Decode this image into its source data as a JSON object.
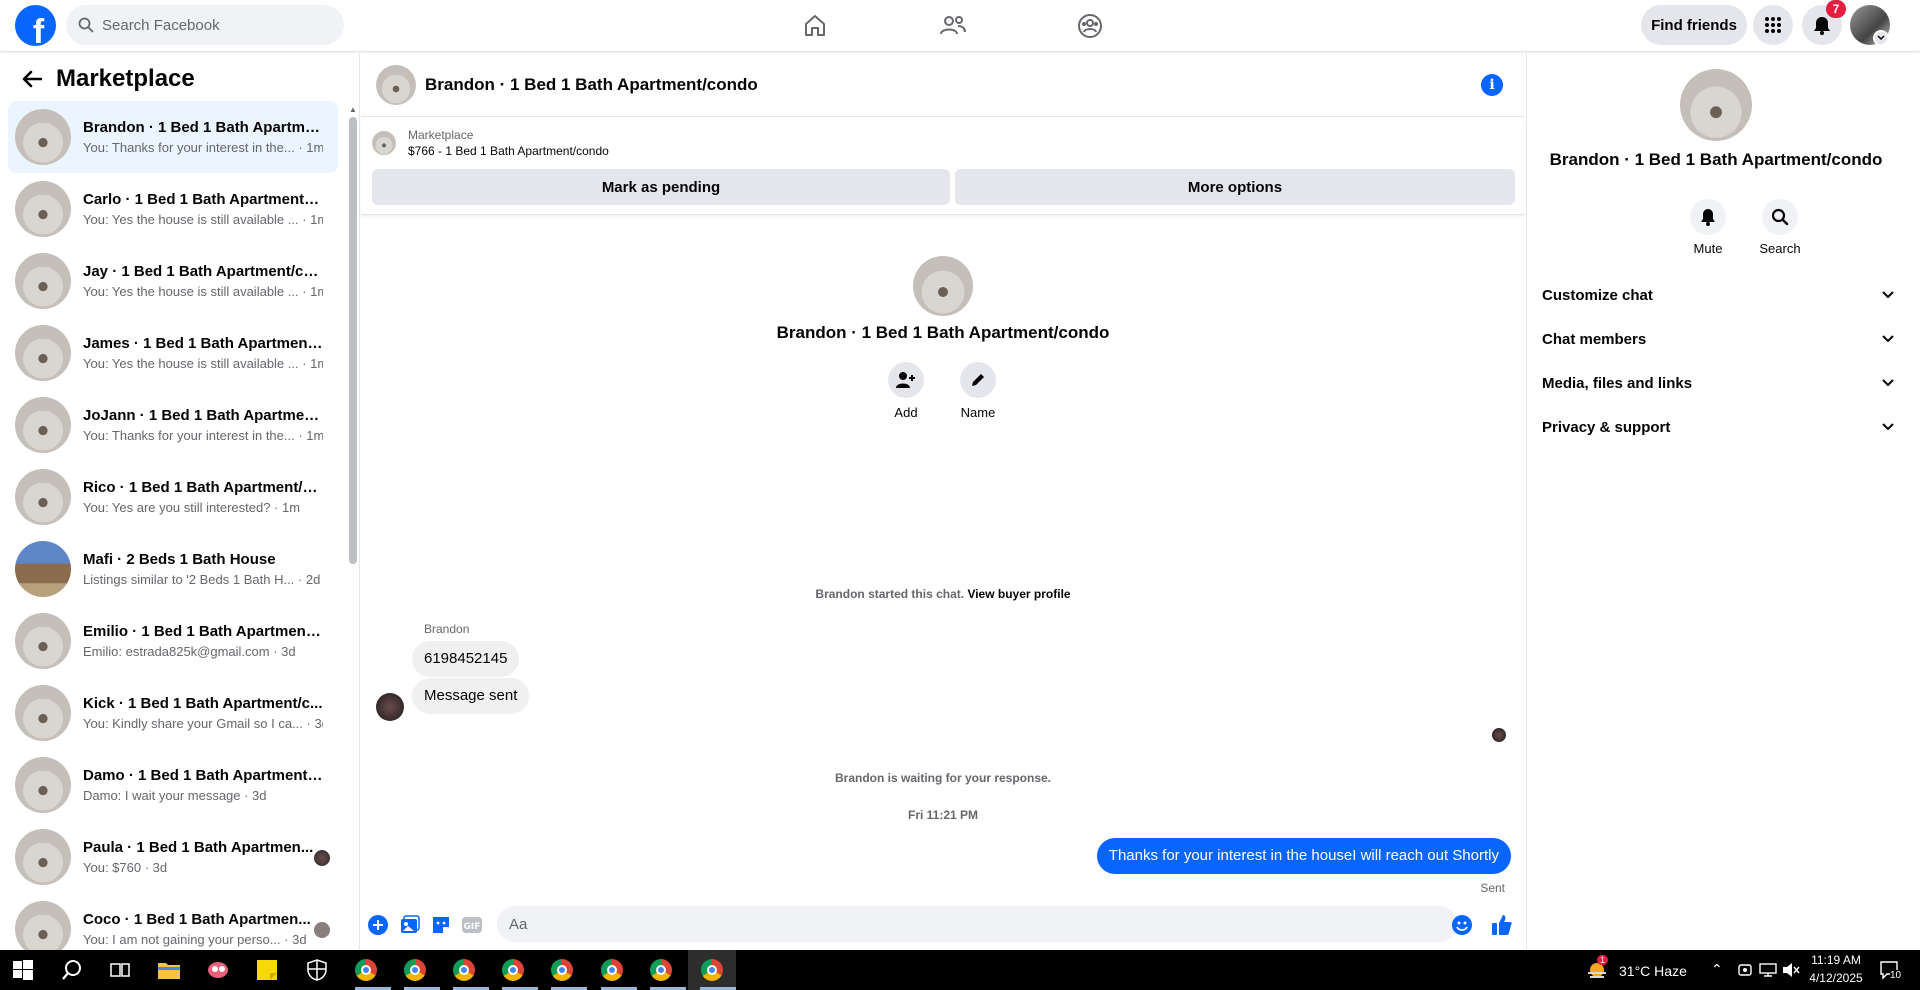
{
  "topbar": {
    "logo": "f",
    "search_placeholder": "Search Facebook",
    "find_friends": "Find friends",
    "notification_count": "7"
  },
  "sidebar": {
    "title": "Marketplace",
    "conversations": [
      {
        "title": "Brandon · 1 Bed 1 Bath Apartme...",
        "sub": "You: Thanks for your interest in the... · 1m"
      },
      {
        "title": "Carlo · 1 Bed 1 Bath Apartment/c...",
        "sub": "You: Yes the house is still available ... · 1m"
      },
      {
        "title": "Jay · 1 Bed 1 Bath Apartment/co...",
        "sub": "You: Yes the house is still available ... · 1m"
      },
      {
        "title": "James · 1 Bed 1 Bath Apartment/...",
        "sub": "You: Yes the house is still available ... · 1m"
      },
      {
        "title": "JoJann · 1 Bed 1 Bath Apartment...",
        "sub": "You: Thanks for your interest in the... · 1m"
      },
      {
        "title": "Rico · 1 Bed 1 Bath Apartment/c...",
        "sub": "You: Yes are you still interested? · 1m"
      },
      {
        "title": "Mafi · 2 Beds 1 Bath House",
        "sub": "Listings similar to '2 Beds 1 Bath H... · 2d"
      },
      {
        "title": "Emilio · 1 Bed 1 Bath Apartment/...",
        "sub": "Emilio: estrada825k@gmail.com · 3d"
      },
      {
        "title": "Kick · 1 Bed 1 Bath Apartment/c...",
        "sub": "You: Kindly share your Gmail so I ca... · 3d"
      },
      {
        "title": "Damo · 1 Bed 1 Bath Apartment/...",
        "sub": "Damo: I wait your message · 3d"
      },
      {
        "title": "Paula · 1 Bed 1 Bath Apartmen...",
        "sub": "You: $760 · 3d"
      },
      {
        "title": "Coco · 1 Bed 1 Bath Apartmen...",
        "sub": "You: I am not gaining your perso... · 3d"
      }
    ]
  },
  "chat": {
    "header_name": "Brandon · 1 Bed 1 Bath Apartment/condo",
    "listing_label": "Marketplace",
    "listing_price": "$766 - 1 Bed 1 Bath Apartment/condo",
    "mark_pending": "Mark as pending",
    "more_options": "More options",
    "intro_name": "Brandon · 1 Bed 1 Bath Apartment/condo",
    "add_label": "Add",
    "name_label": "Name",
    "started_text": "Brandon started this chat.",
    "view_profile": "View buyer profile",
    "sender": "Brandon",
    "msg1": "6198452145",
    "msg2": "Message sent",
    "waiting": "Brandon is waiting for your response.",
    "timestamp": "Fri 11:21 PM",
    "outgoing": "Thanks for your interest in the houseI will reach out Shortly",
    "sent": "Sent",
    "composer_placeholder": "Aa"
  },
  "rpanel": {
    "name": "Brandon · 1 Bed 1 Bath Apartment/condo",
    "mute": "Mute",
    "search": "Search",
    "rows": [
      "Customize chat",
      "Chat members",
      "Media, files and links",
      "Privacy & support"
    ]
  },
  "taskbar": {
    "weather_badge": "1",
    "weather": "31°C  Haze",
    "time": "11:19 AM",
    "date": "4/12/2025",
    "notif": "10"
  }
}
